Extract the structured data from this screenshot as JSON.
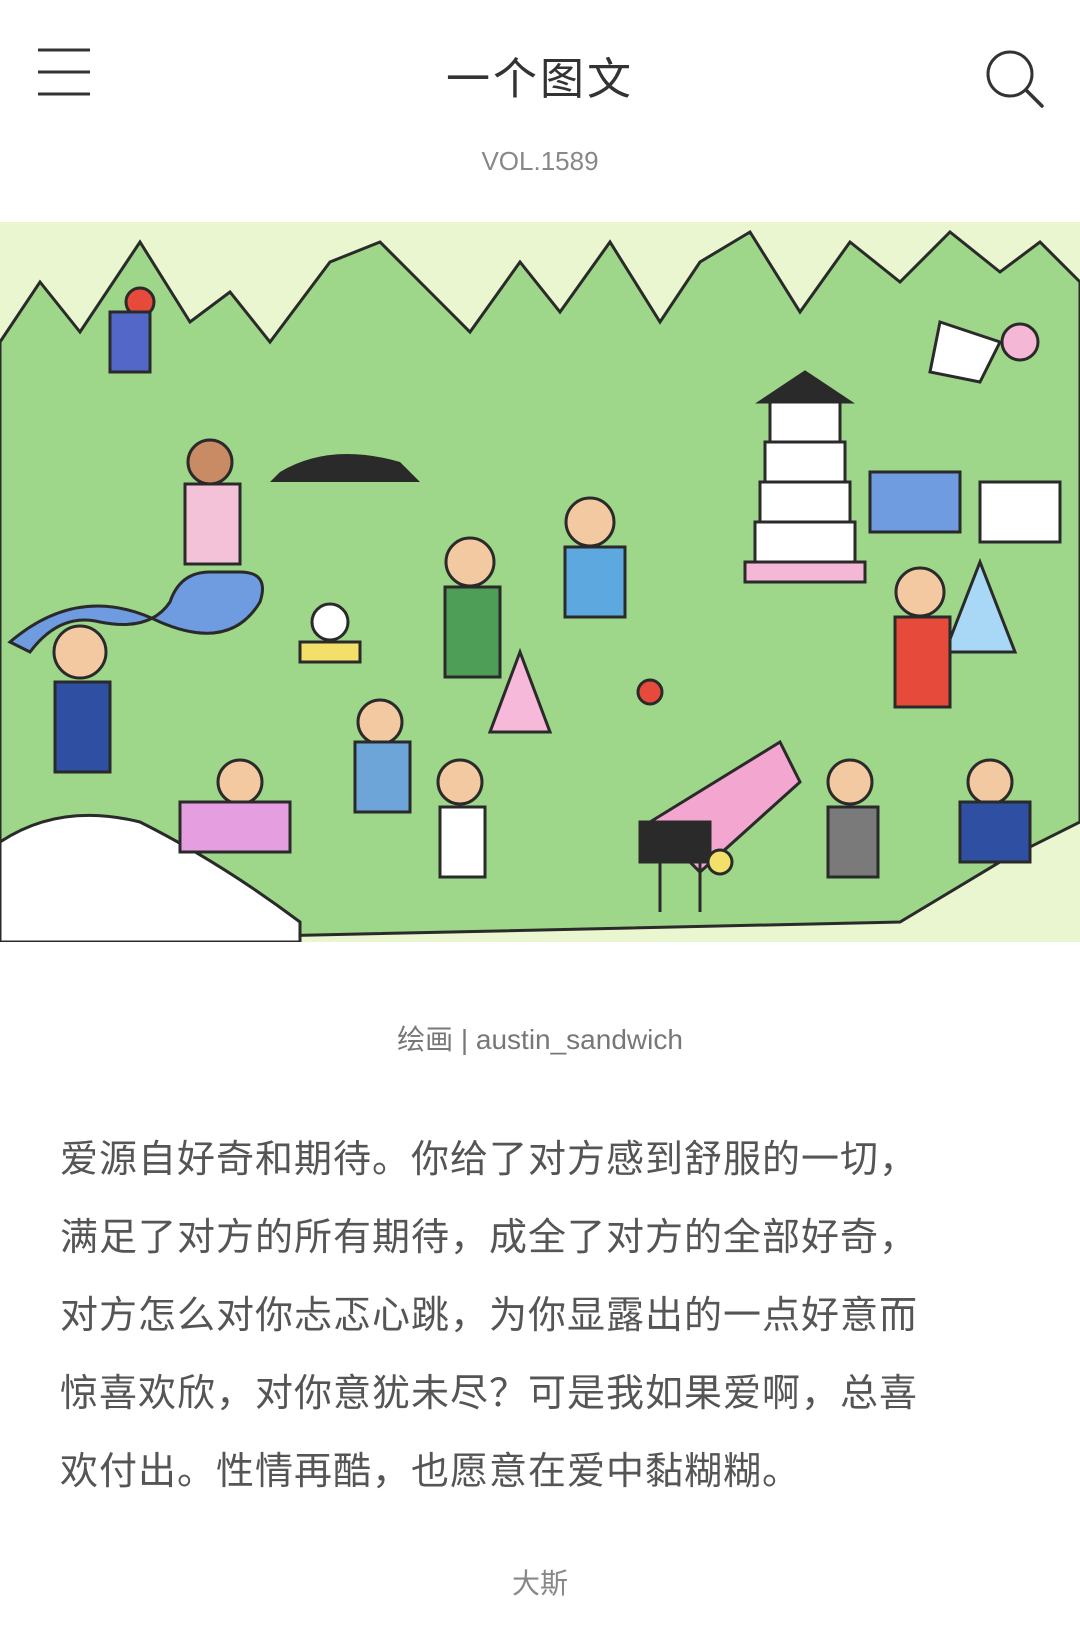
{
  "header": {
    "title": "一个图文",
    "menu_icon": "menu-icon",
    "search_icon": "search-icon"
  },
  "issue": {
    "vol": "VOL.1589"
  },
  "illustration": {
    "subject": "illustration-image"
  },
  "credit": {
    "caption": "绘画 | austin_sandwich"
  },
  "article": {
    "lines": [
      "爱源自好奇和期待。你给了对方感到舒服的一切，",
      "满足了对方的所有期待，成全了对方的全部好奇，",
      "对方怎么对你忐忑心跳，为你显露出的一点好意而",
      "惊喜欢欣，对你意犹未尽？可是我如果爱啊，总喜",
      "欢付出。性情再酷，也愿意在爱中黏糊糊。"
    ]
  },
  "author": {
    "name": "大斯"
  },
  "colors": {
    "sky": "#eaf6cf",
    "grass": "#9ed68a",
    "grass_dark": "#6fb85f",
    "outline": "#2a2a2a",
    "river": "#6f9be0"
  }
}
